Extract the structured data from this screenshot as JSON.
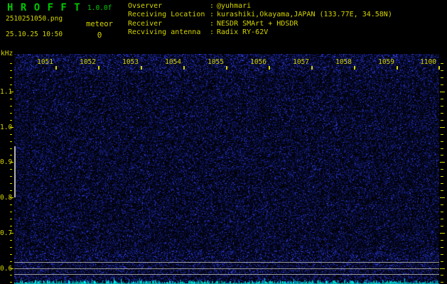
{
  "header": {
    "app_title": "H R O F F T",
    "version": "1.0.0f",
    "filename": "2510251050.png",
    "datetime": "25.10.25 10:50",
    "meteor_label": "meteor",
    "meteor_count": "0",
    "info_rows": [
      {
        "label": "Ovserver",
        "colon": ":",
        "value": "@yuhmari"
      },
      {
        "label": "Receiving Location",
        "colon": ":",
        "value": "kurashiki,Okayama,JAPAN (133.77E, 34.58N)"
      },
      {
        "label": "Receiver",
        "colon": ":",
        "value": "NESDR SMArt + HDSDR"
      },
      {
        "label": "Recviving antenna",
        "colon": ":",
        "value": "Radix RY-62V"
      }
    ]
  },
  "chart_data": {
    "type": "heatmap",
    "title": "HROFFT meteor-echo spectrogram, 10-minute frame 10:51-11:00",
    "ylabel": "kHz",
    "y_major_ticks": [
      "1.1",
      "1.0",
      "0.9",
      "0.8",
      "0.7",
      "0.6"
    ],
    "y_minor_step_khz": 0.02,
    "y_range_khz": [
      0.56,
      1.18
    ],
    "x_ticks": [
      "1051",
      "1052",
      "1053",
      "1054",
      "1055",
      "1056",
      "1057",
      "1058",
      "1059",
      "1100"
    ],
    "grid": false,
    "legend": "none",
    "background": "uniform dark-blue receiver noise on black, no meteor echoes visible",
    "features": {
      "carrier_lines_khz": [
        0.618,
        0.6,
        0.582
      ],
      "left_edge_signal_khz": [
        0.945,
        0.8
      ],
      "signal_level_strip": "jagged cyan audio-level trace along the bottom edge of the plot"
    }
  },
  "colors": {
    "yellow": "#d4d400",
    "green": "#00c800",
    "gray": "#9a9a9a",
    "cyan": "#00d8d8",
    "noise_blue": "#2030c0",
    "background": "#000000"
  }
}
